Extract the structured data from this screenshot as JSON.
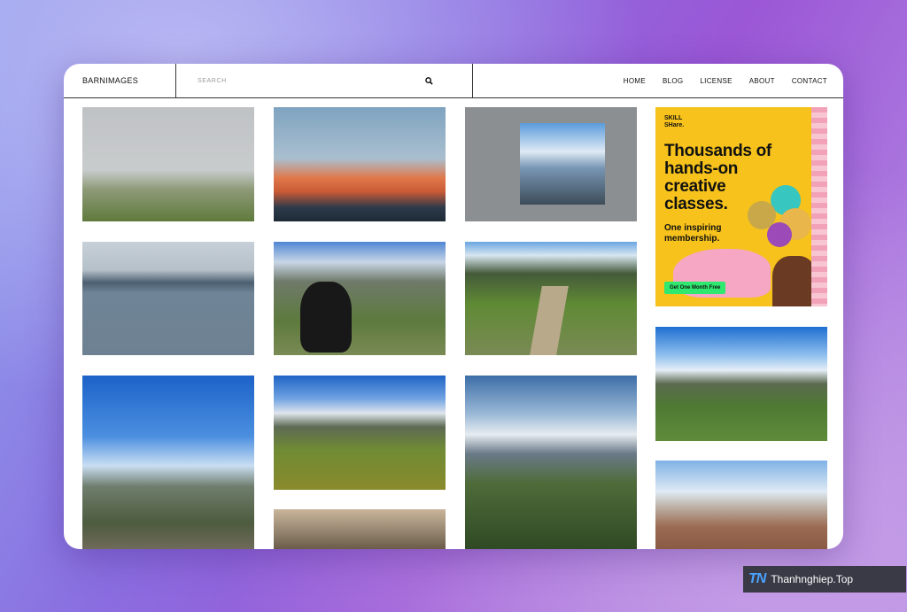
{
  "header": {
    "brand": "BARNIMAGES",
    "search_placeholder": "SEARCH",
    "nav": [
      "HOME",
      "BLOG",
      "LICENSE",
      "ABOUT",
      "CONTACT"
    ]
  },
  "ad": {
    "logo_line1": "SKILL",
    "logo_line2": "SHare.",
    "headline": "Thousands of hands-on creative classes.",
    "subline": "One inspiring membership.",
    "button": "Get One Month Free"
  },
  "watermark": {
    "logo": "TN",
    "text": "Thanhnghiep.Top"
  }
}
